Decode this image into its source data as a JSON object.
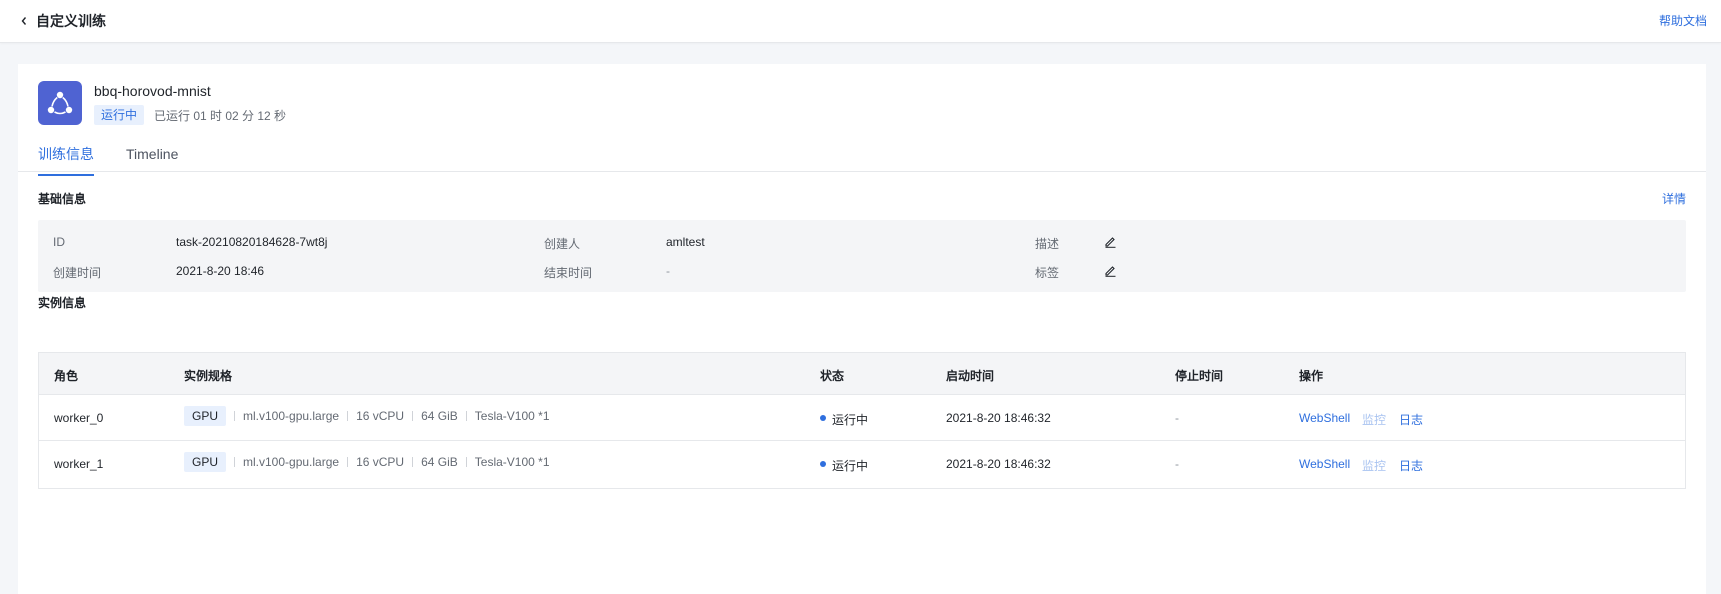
{
  "header": {
    "title": "自定义训练",
    "help_label": "帮助文档"
  },
  "job": {
    "icon": "distributed-network-icon",
    "name": "bbq-horovod-mnist",
    "status": "运行中",
    "runtime": "已运行 01 时 02 分 12 秒"
  },
  "tabs": [
    {
      "label": "训练信息",
      "active": true
    },
    {
      "label": "Timeline",
      "active": false
    }
  ],
  "basic_info": {
    "section_title": "基础信息",
    "detail_label": "详情",
    "fields": {
      "id": {
        "label": "ID",
        "value": "task-20210820184628-7wt8j"
      },
      "creator": {
        "label": "创建人",
        "value": "amltest"
      },
      "description": {
        "label": "描述"
      },
      "created_at": {
        "label": "创建时间",
        "value": "2021-8-20 18:46"
      },
      "ended_at": {
        "label": "结束时间",
        "value": "-"
      },
      "tags": {
        "label": "标签"
      }
    }
  },
  "instances": {
    "section_title": "实例信息",
    "columns": [
      "角色",
      "实例规格",
      "状态",
      "启动时间",
      "停止时间",
      "操作"
    ],
    "rows": [
      {
        "role": "worker_0",
        "spec": {
          "type": "GPU",
          "flavor": "ml.v100-gpu.large",
          "cpu": "16 vCPU",
          "memory": "64 GiB",
          "gpu": "Tesla-V100 *1"
        },
        "status": "运行中",
        "start_time": "2021-8-20 18:46:32",
        "stop_time": "-",
        "actions": [
          "WebShell",
          "监控",
          "日志"
        ]
      },
      {
        "role": "worker_1",
        "spec": {
          "type": "GPU",
          "flavor": "ml.v100-gpu.large",
          "cpu": "16 vCPU",
          "memory": "64 GiB",
          "gpu": "Tesla-V100 *1"
        },
        "status": "运行中",
        "start_time": "2021-8-20 18:46:32",
        "stop_time": "-",
        "actions": [
          "WebShell",
          "监控",
          "日志"
        ]
      }
    ]
  },
  "colors": {
    "accent": "#2f6fde",
    "icon_bg": "#4f63d2",
    "status_dot": "#2f6fde"
  }
}
